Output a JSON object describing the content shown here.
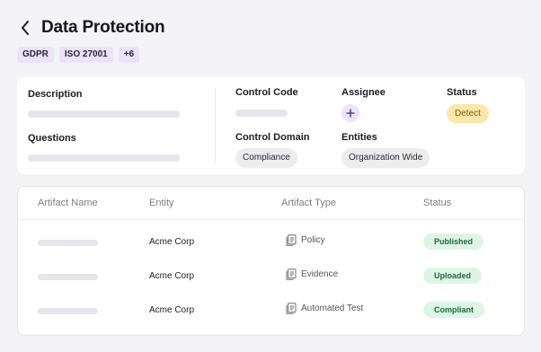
{
  "header": {
    "title": "Data Protection"
  },
  "tags": [
    "GDPR",
    "ISO 27001",
    "+6"
  ],
  "details": {
    "description_label": "Description",
    "questions_label": "Questions",
    "control_code_label": "Control Code",
    "assignee_label": "Assignee",
    "status_label": "Status",
    "status_value": "Detect",
    "control_domain_label": "Control Domain",
    "control_domain_value": "Compliance",
    "entities_label": "Entities",
    "entities_value": "Organization Wide"
  },
  "table": {
    "columns": [
      "Artifact Name",
      "Entity",
      "Artifact Type",
      "Status"
    ],
    "rows": [
      {
        "entity": "Acme Corp",
        "type": "Policy",
        "status": "Published"
      },
      {
        "entity": "Acme Corp",
        "type": "Evidence",
        "status": "Uploaded"
      },
      {
        "entity": "Acme Corp",
        "type": "Automated Test",
        "status": "Compliant"
      }
    ]
  },
  "icons": {
    "back": "chevron-left-icon",
    "add": "plus-icon",
    "document": "document-icon"
  },
  "colors": {
    "tag_bg": "#ece3fb",
    "status_detect_bg": "#fbe8a8",
    "status_detect_text": "#7a5a08",
    "badge_bg": "#def4e7",
    "badge_text": "#1c6b40"
  }
}
